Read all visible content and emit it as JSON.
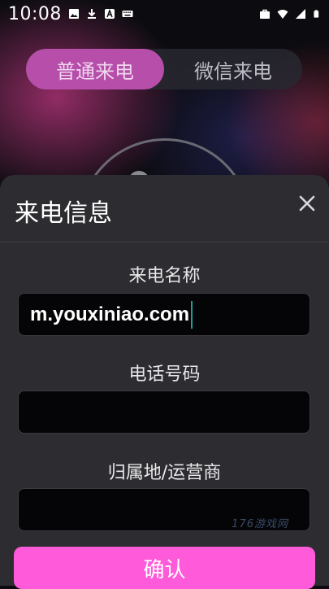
{
  "status_bar": {
    "time": "10:08",
    "left_icons": [
      "image-icon",
      "download-icon",
      "font-a-icon",
      "keyboard-icon"
    ],
    "right_icons": [
      "briefcase-icon",
      "wifi-icon",
      "signal-icon",
      "battery-icon"
    ]
  },
  "call_type_toggle": {
    "options": [
      "普通来电",
      "微信来电"
    ],
    "selected": "普通来电"
  },
  "dialog": {
    "title": "来电信息",
    "fields": [
      {
        "label": "来电名称",
        "value": "m.youxiniao.com"
      },
      {
        "label": "电话号码",
        "value": ""
      },
      {
        "label": "归属地/运营商",
        "value": ""
      }
    ],
    "confirm_label": "确认",
    "watermark": "176游戏网"
  },
  "colors": {
    "accent": "#ff5ad9",
    "toggle_active": "#b64eaa",
    "sheet_bg": "#2d2d31",
    "caret": "#1aa29a"
  }
}
